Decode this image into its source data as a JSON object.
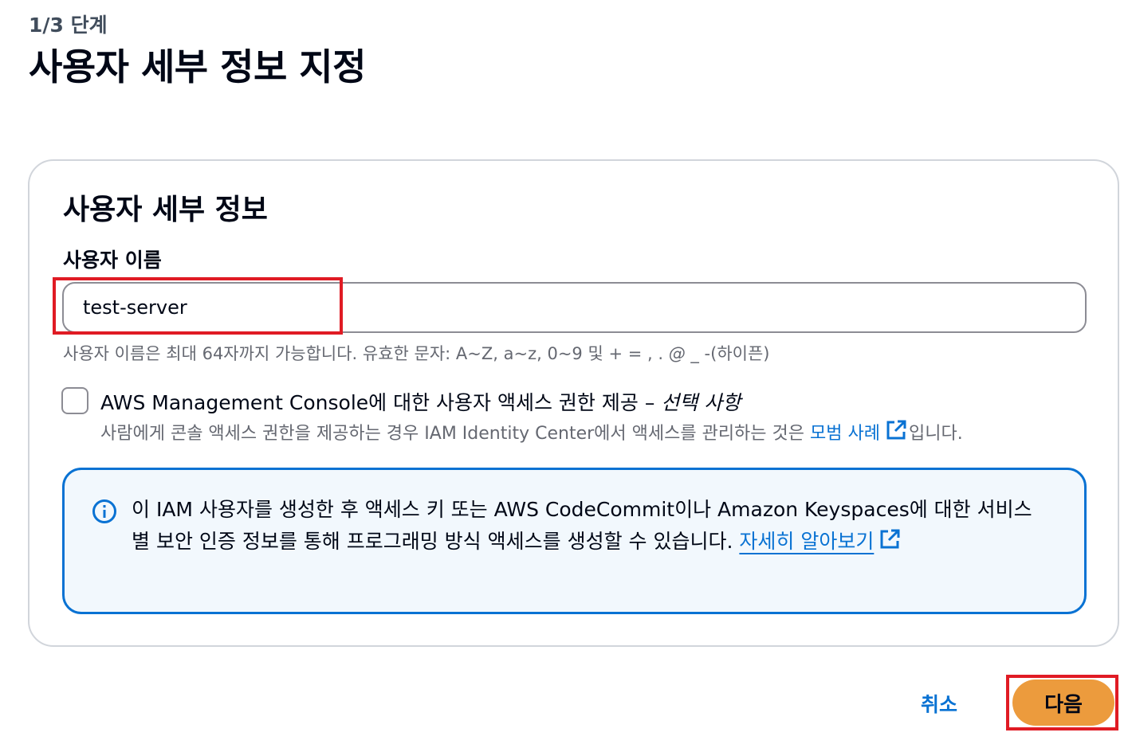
{
  "header": {
    "step": "1/3 단계",
    "title": "사용자 세부 정보 지정"
  },
  "details": {
    "section_title": "사용자 세부 정보",
    "username_label": "사용자 이름",
    "username_value": "test-server",
    "constraint_text": "사용자 이름은 최대 64자까지 가능합니다. 유효한 문자: A~Z, a~z, 0~9 및 + = , . ",
    "constraint_tail": "_ -(하이픈)",
    "console_access": {
      "label": "AWS Management Console에 대한 사용자 액세스 권한 제공 – ",
      "optional_label": "선택 사항",
      "checked": false,
      "desc_prefix": "사람에게 콘솔 액세스 권한을 제공하는 경우 IAM Identity Center에서 액세스를 관리하는 것은 ",
      "desc_link": "모범 사례",
      "desc_suffix": "입니다."
    },
    "info": {
      "text": "이 IAM 사용자를 생성한 후 액세스 키 또는 AWS CodeCommit이나 Amazon Keyspaces에 대한 서비스별 보안 인증 정보를 통해 프로그래밍 방식 액세스를 생성할 수 있습니다. ",
      "link": "자세히 알아보기"
    }
  },
  "actions": {
    "cancel_label": "취소",
    "next_label": "다음"
  },
  "colors": {
    "accent": "#0972d3",
    "primary_button": "#ec9b3d",
    "highlight": "#e01b24"
  }
}
